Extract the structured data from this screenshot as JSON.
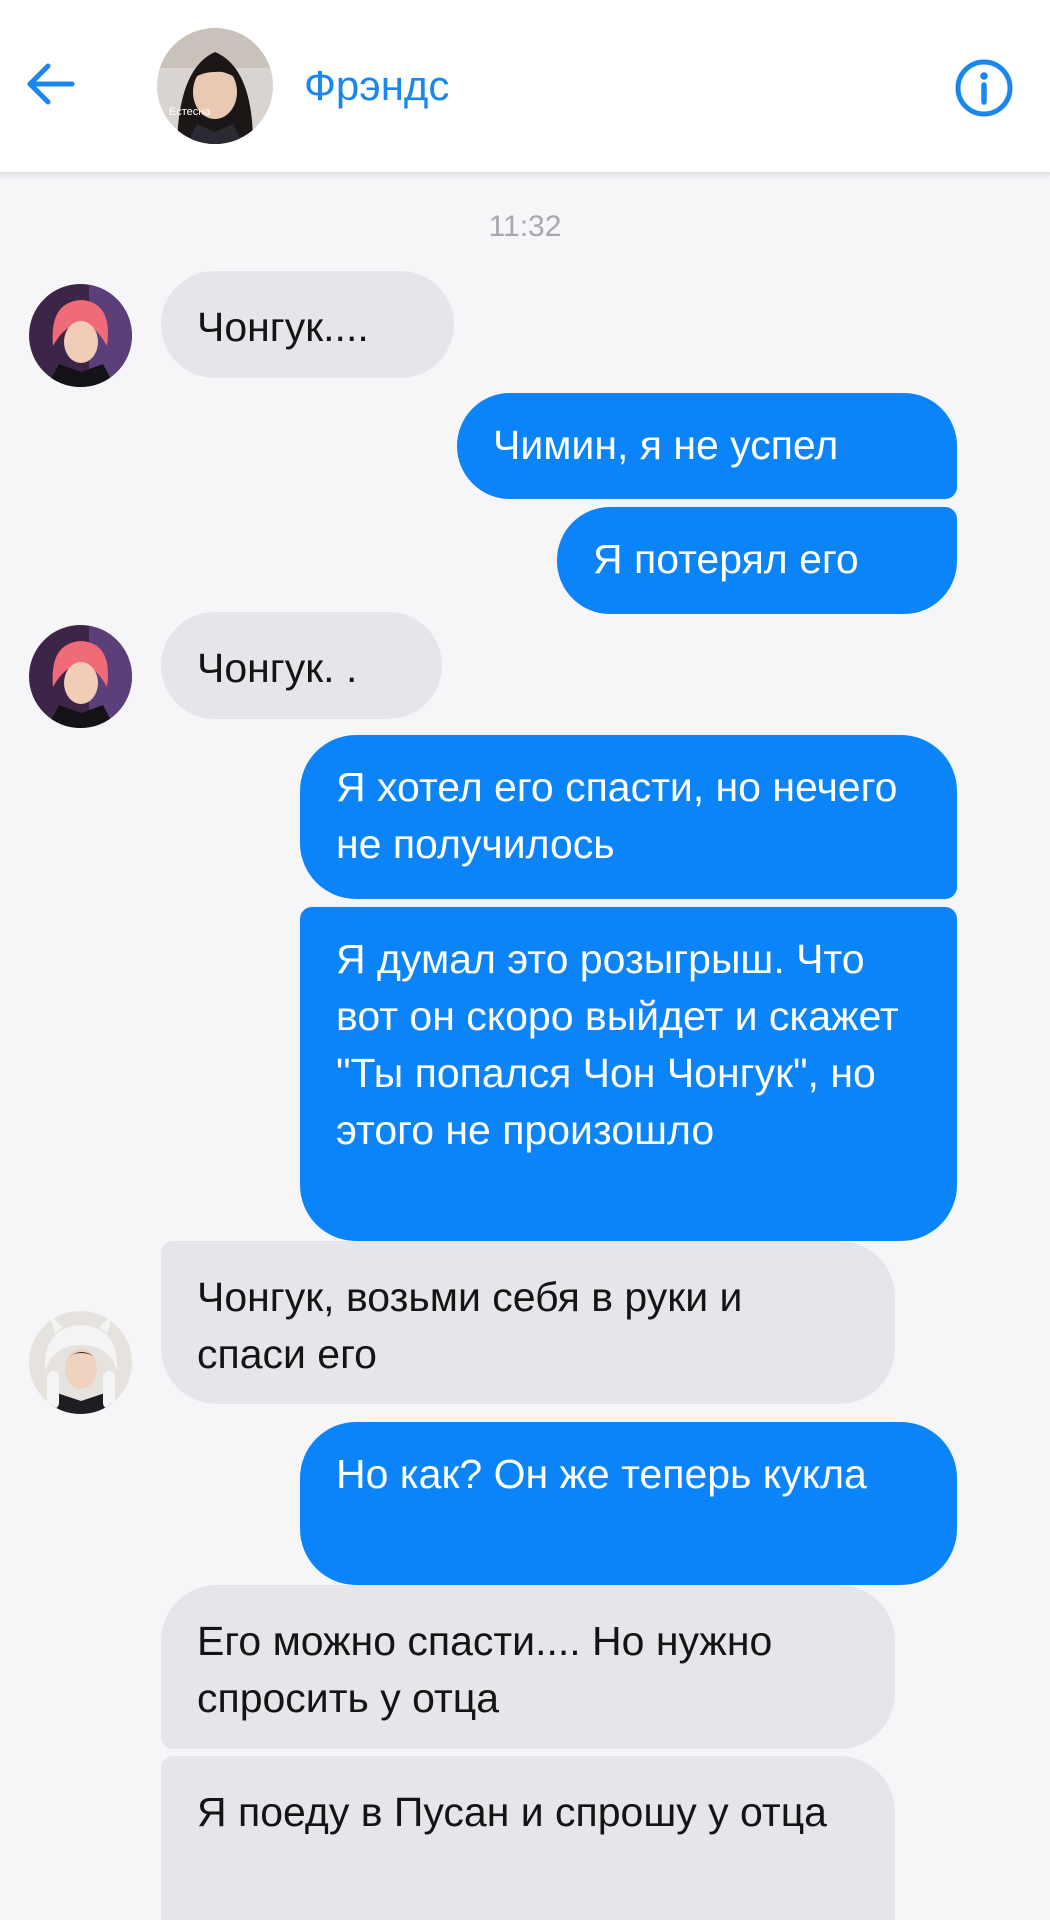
{
  "header": {
    "title": "Фрэндс",
    "avatar_caption": "Естесна",
    "back_icon": "arrow-left-icon",
    "info_icon": "info-icon",
    "accent_color": "#1a86f0"
  },
  "timestamp": "11:32",
  "colors": {
    "outgoing_bubble": "#0a84f8",
    "incoming_bubble": "#e6e6ea"
  },
  "messages": [
    {
      "side": "in",
      "sender": "pink-hair",
      "text": "Чонгук...."
    },
    {
      "side": "out",
      "text": "Чимин, я не успел"
    },
    {
      "side": "out",
      "text": "Я потерял его"
    },
    {
      "side": "in",
      "sender": "pink-hair",
      "text": "Чонгук. ."
    },
    {
      "side": "out",
      "text": "Я хотел его спасти, но нечего не получилось"
    },
    {
      "side": "out",
      "text": "Я думал это розыгрыш. Что вот он скоро выйдет и скажет \"Ты попался Чон Чонгук\", но этого не произошло"
    },
    {
      "side": "in",
      "sender": "white-hat",
      "text": "Чонгук, возьми себя в руки и спаси его"
    },
    {
      "side": "out",
      "text": "Но как? Он же теперь кукла"
    },
    {
      "side": "in",
      "sender": "white-hat",
      "text": "Его можно спасти.... Но нужно спросить у отца"
    },
    {
      "side": "in",
      "sender": "white-hat",
      "text": "Я поеду в Пусан и спрошу у отца"
    }
  ]
}
